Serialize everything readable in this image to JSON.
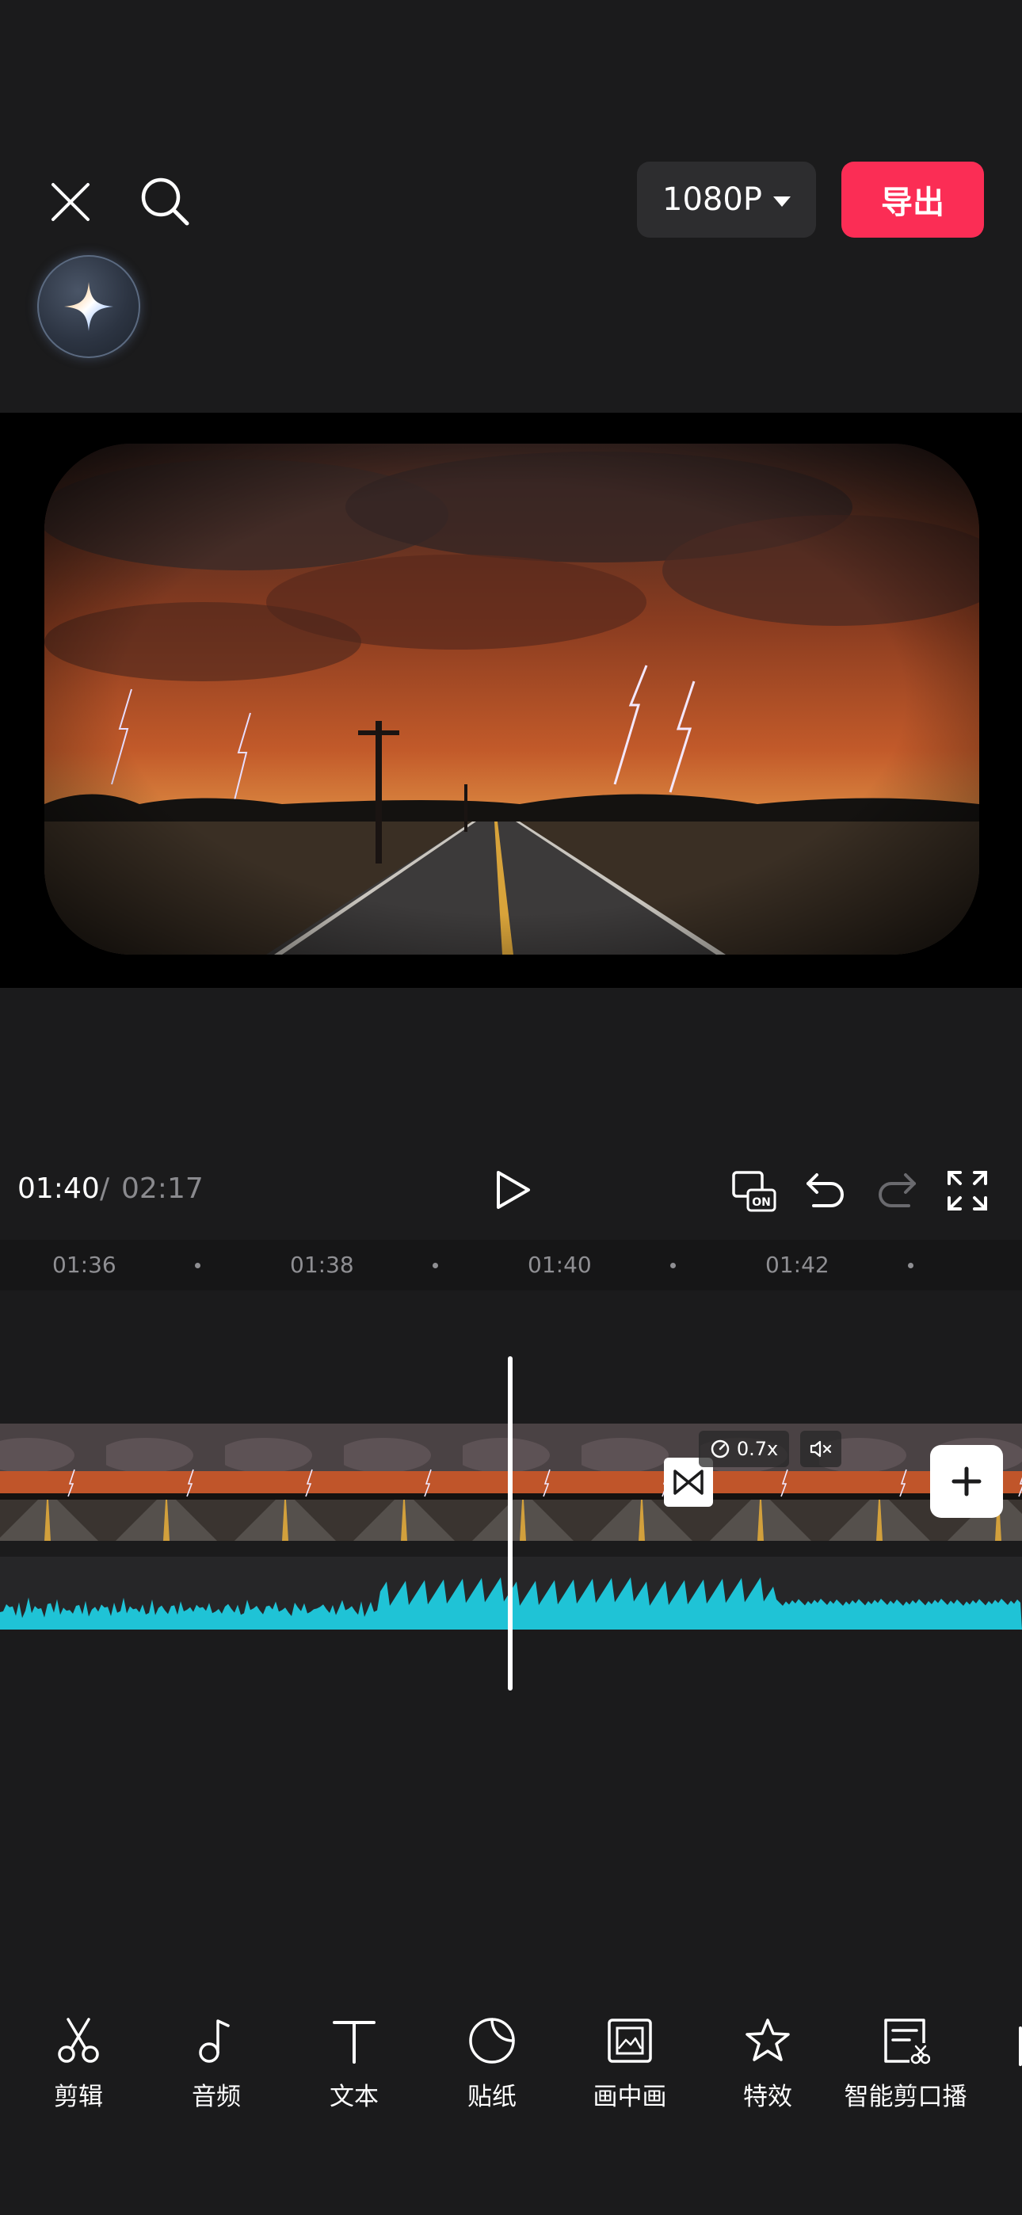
{
  "top_bar": {
    "resolution_label": "1080P",
    "export_label": "导出"
  },
  "playback": {
    "current_time": "01:40",
    "separator": "/",
    "total_time": "02:17"
  },
  "ruler": {
    "labels": [
      "01:36",
      "01:38",
      "01:40",
      "01:42"
    ]
  },
  "clip": {
    "speed_label": "0.7x"
  },
  "toolbar": {
    "items": [
      {
        "label": "剪辑",
        "icon": "scissors-icon"
      },
      {
        "label": "音频",
        "icon": "music-note-icon"
      },
      {
        "label": "文本",
        "icon": "text-icon"
      },
      {
        "label": "贴纸",
        "icon": "sticker-icon"
      },
      {
        "label": "画中画",
        "icon": "picture-in-picture-icon"
      },
      {
        "label": "特效",
        "icon": "effects-star-icon"
      },
      {
        "label": "智能剪口播",
        "icon": "smart-cut-icon"
      }
    ]
  },
  "colors": {
    "background": "#1b1b1c",
    "export_button": "#fb2d55",
    "waveform": "#1fc3d6"
  }
}
